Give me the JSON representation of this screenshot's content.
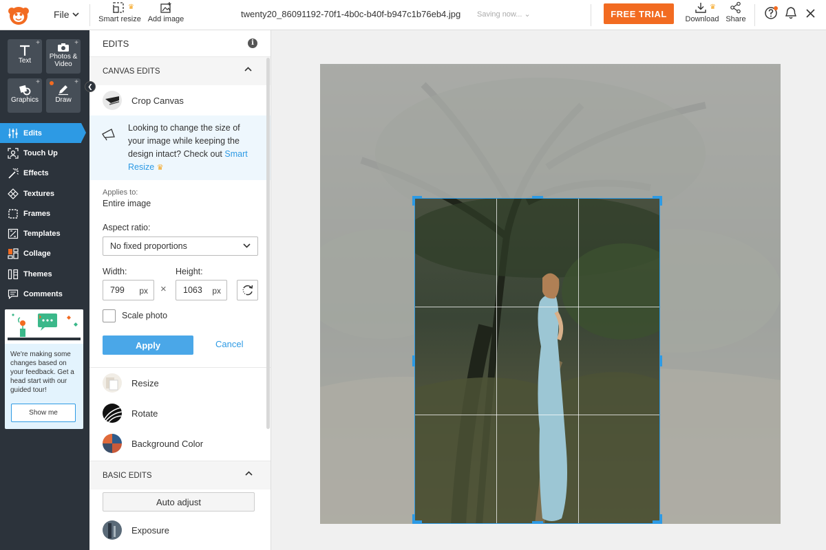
{
  "topbar": {
    "file_label": "File",
    "smart_resize_label": "Smart resize",
    "add_image_label": "Add image",
    "filename": "twenty20_86091192-70f1-4b0c-b40f-b947c1b76eb4.jpg",
    "saving_status": "Saving now...",
    "free_trial_label": "FREE TRIAL",
    "download_label": "Download",
    "share_label": "Share"
  },
  "sidebar": {
    "tools": [
      {
        "label": "Text"
      },
      {
        "label": "Photos & Video"
      },
      {
        "label": "Graphics"
      },
      {
        "label": "Draw"
      }
    ],
    "nav": [
      {
        "label": "Edits",
        "icon": "sliders-icon"
      },
      {
        "label": "Touch Up",
        "icon": "face-scan-icon"
      },
      {
        "label": "Effects",
        "icon": "magic-wand-icon"
      },
      {
        "label": "Textures",
        "icon": "texture-icon"
      },
      {
        "label": "Frames",
        "icon": "frame-icon"
      },
      {
        "label": "Templates",
        "icon": "template-icon"
      },
      {
        "label": "Collage",
        "icon": "collage-icon"
      },
      {
        "label": "Themes",
        "icon": "themes-icon"
      },
      {
        "label": "Comments",
        "icon": "comment-icon"
      }
    ],
    "promo_text": "We're making some changes based on your feedback. Get a head start with our guided tour!",
    "promo_button": "Show me"
  },
  "panel": {
    "title": "EDITS",
    "canvas_edits_title": "CANVAS EDITS",
    "crop_canvas_label": "Crop Canvas",
    "tip_text": "Looking to change the size of your image while keeping the design intact? Check out",
    "tip_link": "Smart Resize",
    "applies_to_label": "Applies to:",
    "applies_to_value": "Entire image",
    "aspect_ratio_label": "Aspect ratio:",
    "aspect_ratio_value": "No fixed proportions",
    "width_label": "Width:",
    "height_label": "Height:",
    "width_value": "799",
    "height_value": "1063",
    "unit": "px",
    "times_symbol": "×",
    "scale_photo_label": "Scale photo",
    "apply_label": "Apply",
    "cancel_label": "Cancel",
    "resize_label": "Resize",
    "rotate_label": "Rotate",
    "background_color_label": "Background Color",
    "basic_edits_title": "BASIC EDITS",
    "auto_adjust_label": "Auto adjust",
    "exposure_label": "Exposure"
  },
  "colors": {
    "accent": "#2d9ae4",
    "brand_orange": "#f26b21",
    "sidebar_bg": "#2c333b"
  }
}
